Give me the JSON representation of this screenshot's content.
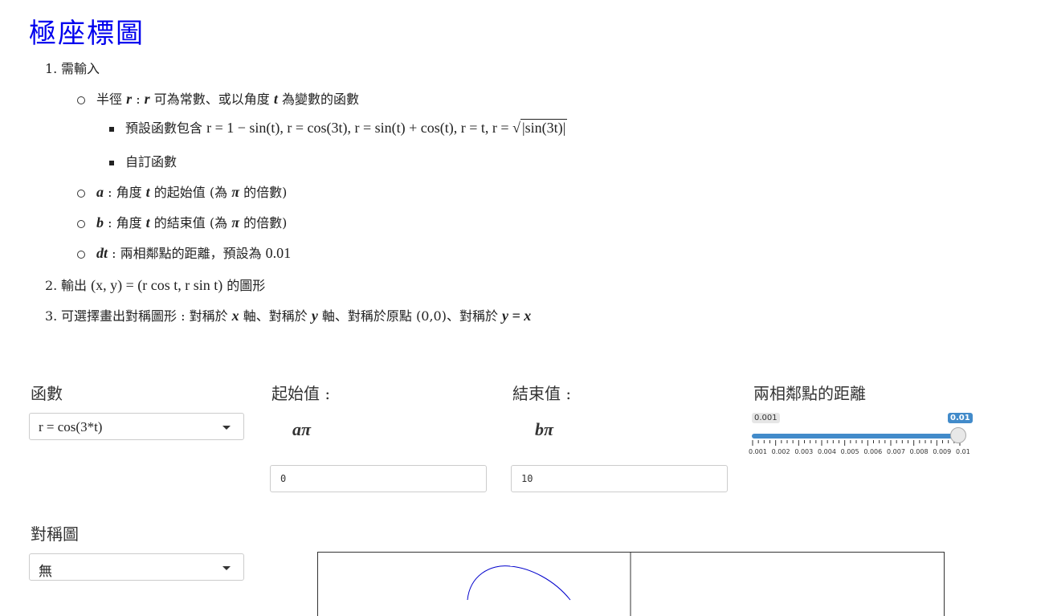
{
  "title": "極座標圖",
  "list": {
    "n1": "1.",
    "item1": "需輸入",
    "r_item": {
      "var": "r",
      "sep": " : ",
      "var2": "r",
      "text": " 可為常數、或以角度 ",
      "t": "t",
      "text2": " 為變數的函數"
    },
    "preset": {
      "text": "預設函數包含 ",
      "formula": "r = 1 − sin(t), r = cos(3t), r = sin(t) + cos(t), r = t, r = ",
      "sqrt_content": "|sin(3t)|"
    },
    "custom": "自訂函數",
    "a_item": {
      "var": "a",
      "text": " : 角度 ",
      "t": "t",
      "text2": " 的起始值 (為 ",
      "pi": "π",
      "text3": " 的倍數)"
    },
    "b_item": {
      "var": "b",
      "text": " : 角度 ",
      "t": "t",
      "text2": " 的結束值 (為 ",
      "pi": "π",
      "text3": " 的倍數)"
    },
    "dt_item": {
      "var": "dt",
      "text": " : 兩相鄰點的距離，預設為 ",
      "val": "0.01"
    },
    "n2": "2.",
    "item2": {
      "text": "輸出 ",
      "formula": "(x, y) = (r cos t, r sin t)",
      "text2": " 的圖形"
    },
    "n3": "3.",
    "item3": {
      "text": "可選擇畫出對稱圖形 : 對稱於 ",
      "x": "x",
      "t1": " 軸、對稱於 ",
      "y": "y",
      "t2": " 軸、對稱於原點 (0,0)、對稱於 ",
      "eq": "y = x"
    }
  },
  "controls": {
    "func_label": "函數",
    "func_value": "r = cos(3*t)",
    "start_label": "起始值 :",
    "start_sym": "aπ",
    "start_value": "0",
    "end_label": "結束值 :",
    "end_sym": "bπ",
    "end_value": "10",
    "dist_label": "兩相鄰點的距離",
    "slider_min_label": "0.001",
    "slider_current": "0.01",
    "slider_value_fraction": 1.0,
    "slider_ticks": [
      "0.001",
      "0.002",
      "0.003",
      "0.004",
      "0.005",
      "0.006",
      "0.007",
      "0.008",
      "0.009",
      "0.01"
    ],
    "sym_label": "對稱圖",
    "sym_value": "無"
  },
  "colors": {
    "title": "#0000ee",
    "accent": "#428bca",
    "curve": "#0000cc"
  }
}
